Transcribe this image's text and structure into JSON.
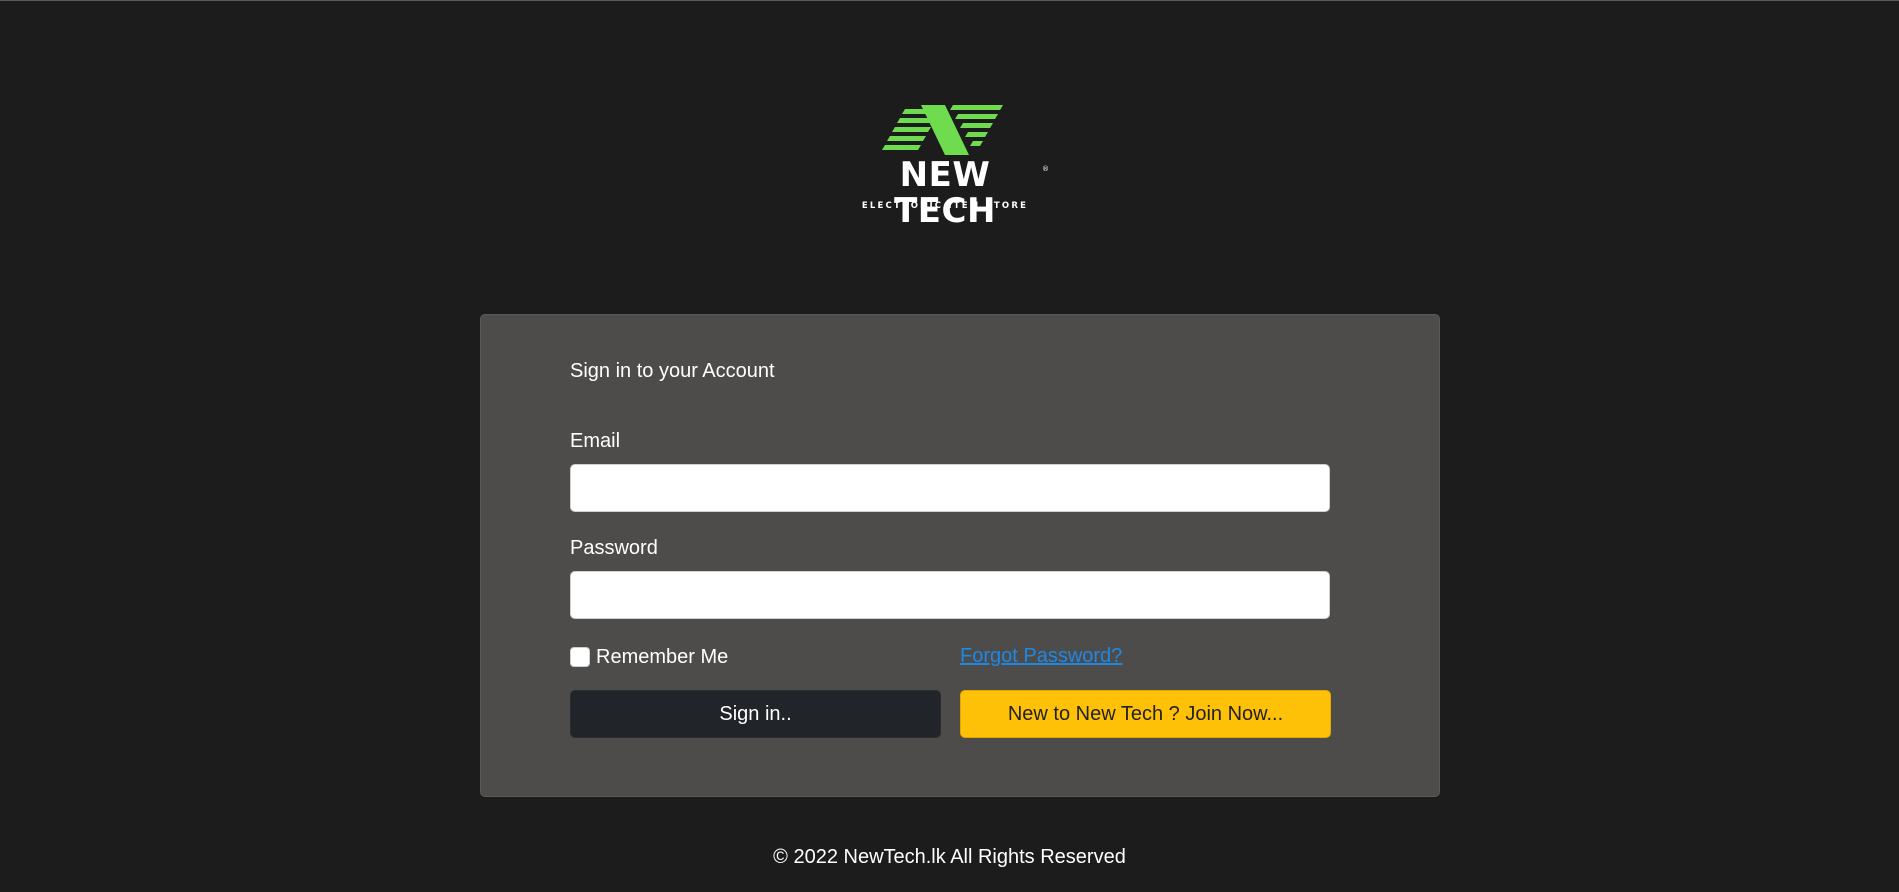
{
  "brand": {
    "name": "NEW TECH",
    "registered_mark": "®",
    "tagline": "ELECTRONIC ITEM STORE",
    "accent_color": "#6fdc4f"
  },
  "login_card": {
    "title": "Sign in to your Account",
    "email_label": "Email",
    "email_value": "",
    "password_label": "Password",
    "password_value": "",
    "remember_me_label": "Remember Me",
    "remember_me_checked": false,
    "forgot_password_link": "Forgot Password?",
    "signin_button": "Sign in..",
    "join_button": "New to New Tech ? Join Now..."
  },
  "colors": {
    "background": "#1c1c1c",
    "card": "#4d4c4a",
    "signin_button": "#212429",
    "join_button": "#ffc107",
    "link": "#1e88e5"
  },
  "footer": {
    "copyright": "© 2022 NewTech.lk All Rights Reserved"
  }
}
